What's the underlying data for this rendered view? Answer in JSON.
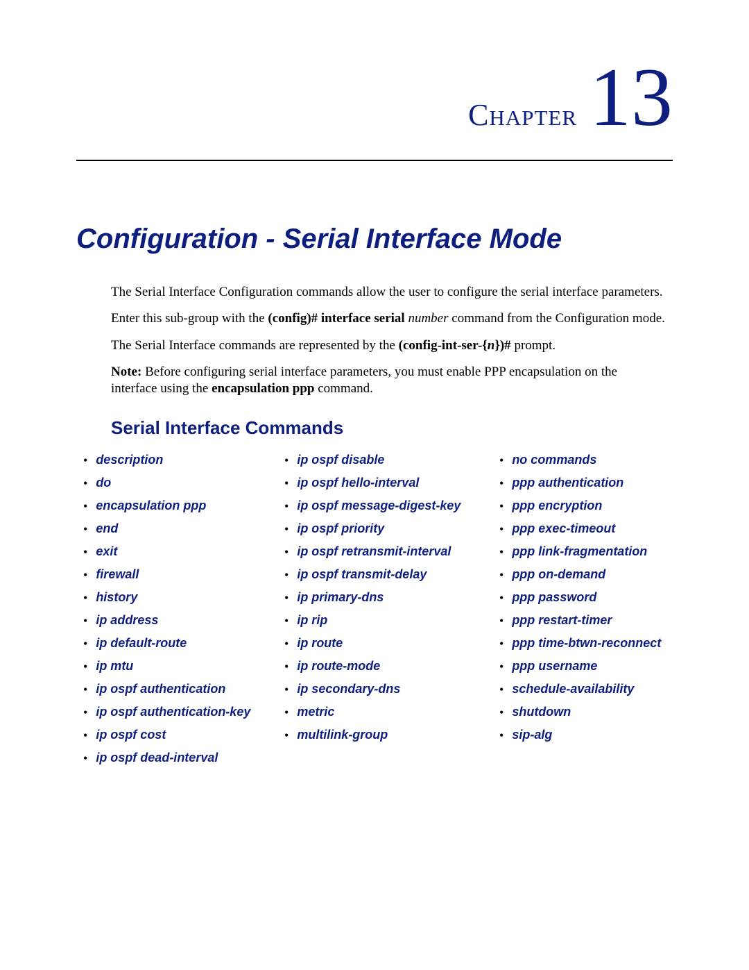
{
  "chapter": {
    "label": "Chapter",
    "number": "13"
  },
  "title": "Configuration - Serial Interface Mode",
  "intro": {
    "p1": "The Serial Interface Configuration commands allow the user to configure the serial interface parameters.",
    "p2a": "Enter this sub-group with the ",
    "p2b": "(config)# interface serial ",
    "p2c": "number",
    "p2d": " command from the Configuration mode.",
    "p3a": "The Serial Interface commands are represented by the ",
    "p3b": "(config-int-ser-{",
    "p3c": "n",
    "p3d": "})#",
    "p3e": " prompt.",
    "p4a": "Note:",
    "p4b": "  Before configuring serial interface parameters, you must enable PPP encapsulation on the interface using the ",
    "p4c": "encapsulation ppp",
    "p4d": " command."
  },
  "section_header": "Serial Interface Commands",
  "commands": {
    "col1": [
      "description",
      "do",
      "encapsulation ppp",
      "end",
      "exit",
      "firewall",
      "history",
      "ip address",
      "ip default-route",
      "ip mtu",
      "ip ospf authentication",
      "ip ospf authentication-key",
      "ip ospf cost",
      "ip ospf dead-interval"
    ],
    "col2": [
      "ip ospf disable",
      "ip ospf hello-interval",
      "ip ospf message-digest-key",
      "ip ospf priority",
      "ip ospf retransmit-interval",
      "ip ospf transmit-delay",
      "ip primary-dns",
      "ip rip",
      "ip route",
      "ip route-mode",
      "ip secondary-dns",
      "metric",
      "multilink-group"
    ],
    "col3": [
      "no commands",
      "ppp authentication",
      "ppp encryption",
      "ppp exec-timeout",
      "ppp link-fragmentation",
      "ppp on-demand",
      "ppp password",
      "ppp restart-timer",
      "ppp time-btwn-reconnect",
      "ppp username",
      "schedule-availability",
      "shutdown",
      "sip-alg"
    ]
  }
}
